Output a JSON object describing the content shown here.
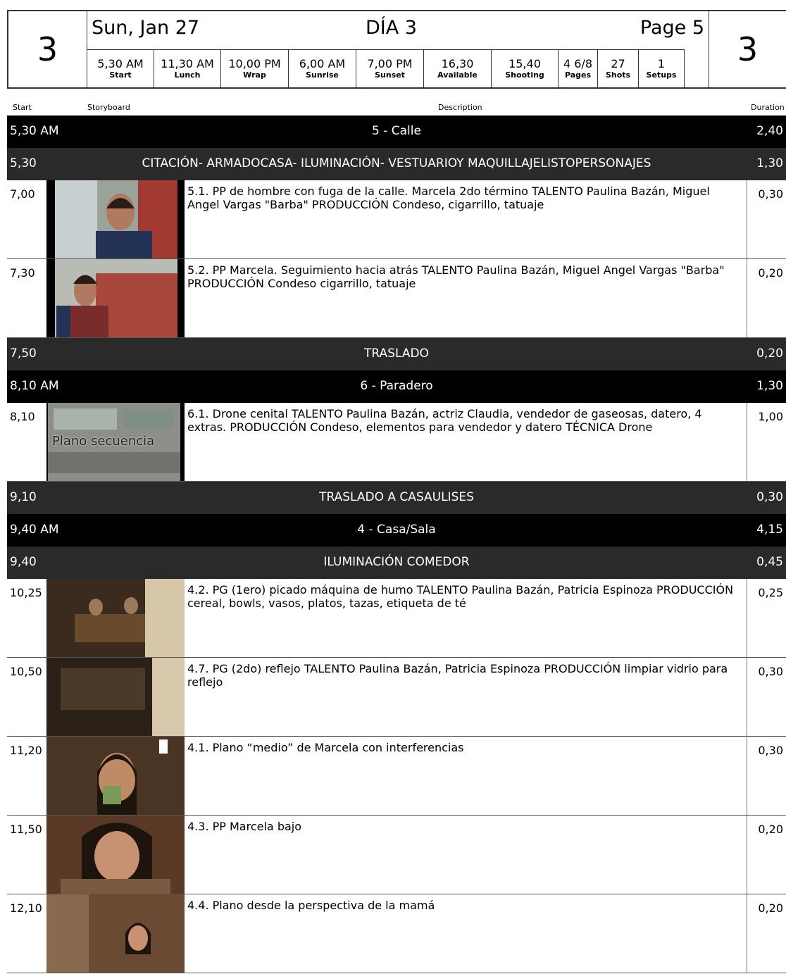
{
  "header": {
    "day_number": "3",
    "date": "Sun, Jan 27",
    "day_label": "DÍA 3",
    "page": "Page 5",
    "stats": [
      {
        "value": "5,30 AM",
        "label": "Start"
      },
      {
        "value": "11,30 AM",
        "label": "Lunch"
      },
      {
        "value": "10,00 PM",
        "label": "Wrap"
      },
      {
        "value": "6,00 AM",
        "label": "Sunrise"
      },
      {
        "value": "7,00 PM",
        "label": "Sunset"
      },
      {
        "value": "16,30",
        "label": "Available"
      },
      {
        "value": "15,40",
        "label": "Shooting"
      },
      {
        "value": "4 6/8",
        "label": "Pages"
      },
      {
        "value": "27",
        "label": "Shots"
      },
      {
        "value": "1",
        "label": "Setups"
      }
    ]
  },
  "columns": {
    "start": "Start",
    "storyboard": "Storyboard",
    "description": "Description",
    "duration": "Duration"
  },
  "rows": [
    {
      "kind": "scene",
      "start": "5,30 AM",
      "text": "5 - Calle",
      "duration": "2,40"
    },
    {
      "kind": "banner",
      "start": "5,30",
      "text": "CITACIÓN- ARMADOCASA- ILUMINACIÓN- VESTUARIOY MAQUILLAJELISTOPERSONAJES",
      "duration": "1,30"
    },
    {
      "kind": "shot",
      "start": "7,00",
      "description": "5.1. PP de hombre con fuga de la calle. Marcela 2do término TALENTO Paulina Bazán, Miguel Angel Vargas \"Barba\" PRODUCCIÓN Condeso, cigarrillo, tatuaje",
      "duration": "0,30",
      "thumb": "street-man"
    },
    {
      "kind": "shot",
      "start": "7,30",
      "description": "5.2. PP Marcela. Seguimiento hacia atrás TALENTO Paulina Bazán, Miguel Angel Vargas \"Barba\" PRODUCCIÓN Condeso cigarrillo, tatuaje",
      "duration": "0,20",
      "thumb": "street-man-2"
    },
    {
      "kind": "banner",
      "start": "7,50",
      "text": "TRASLADO",
      "duration": "0,20"
    },
    {
      "kind": "scene",
      "start": "8,10 AM",
      "text": "6 - Paradero",
      "duration": "1,30"
    },
    {
      "kind": "shot",
      "start": "8,10",
      "description": "6.1. Drone cenital TALENTO Paulina Bazán, actriz Claudia, vendedor de gaseosas, datero, 4 extras. PRODUCCIÓN Condeso, elementos para vendedor y datero TÉCNICA Drone",
      "duration": "1,00",
      "thumb": "drone",
      "thumb_caption": "Plano secuencia"
    },
    {
      "kind": "banner",
      "start": "9,10",
      "text": "TRASLADO A CASAULISES",
      "duration": "0,30"
    },
    {
      "kind": "scene",
      "start": "9,40 AM",
      "text": "4 - Casa/Sala",
      "duration": "4,15"
    },
    {
      "kind": "banner",
      "start": "9,40",
      "text": "ILUMINACIÓN COMEDOR",
      "duration": "0,45"
    },
    {
      "kind": "shot",
      "start": "10,25",
      "description": "4.2. PG (1ero) picado máquina de humo TALENTO Paulina Bazán, Patricia Espinoza PRODUCCIÓN cereal, bowls, vasos, platos, tazas, etiqueta de té",
      "duration": "0,25",
      "thumb": "dining"
    },
    {
      "kind": "shot",
      "start": "10,50",
      "description": "4.7. PG (2do) reflejo TALENTO Paulina Bazán, Patricia Espinoza PRODUCCIÓN limpiar vidrio para reflejo",
      "duration": "0,30",
      "thumb": "reflection"
    },
    {
      "kind": "shot",
      "start": "11,20",
      "description": "4.1. Plano “medio” de Marcela con interferencias",
      "duration": "0,30",
      "thumb": "woman-cup"
    },
    {
      "kind": "shot",
      "start": "11,50",
      "description": "4.3. PP Marcela bajo",
      "duration": "0,20",
      "thumb": "woman-low"
    },
    {
      "kind": "shot",
      "start": "12,10",
      "description": "4.4. Plano desde la perspectiva de la mamá",
      "duration": "0,20",
      "thumb": "woman-far"
    }
  ]
}
